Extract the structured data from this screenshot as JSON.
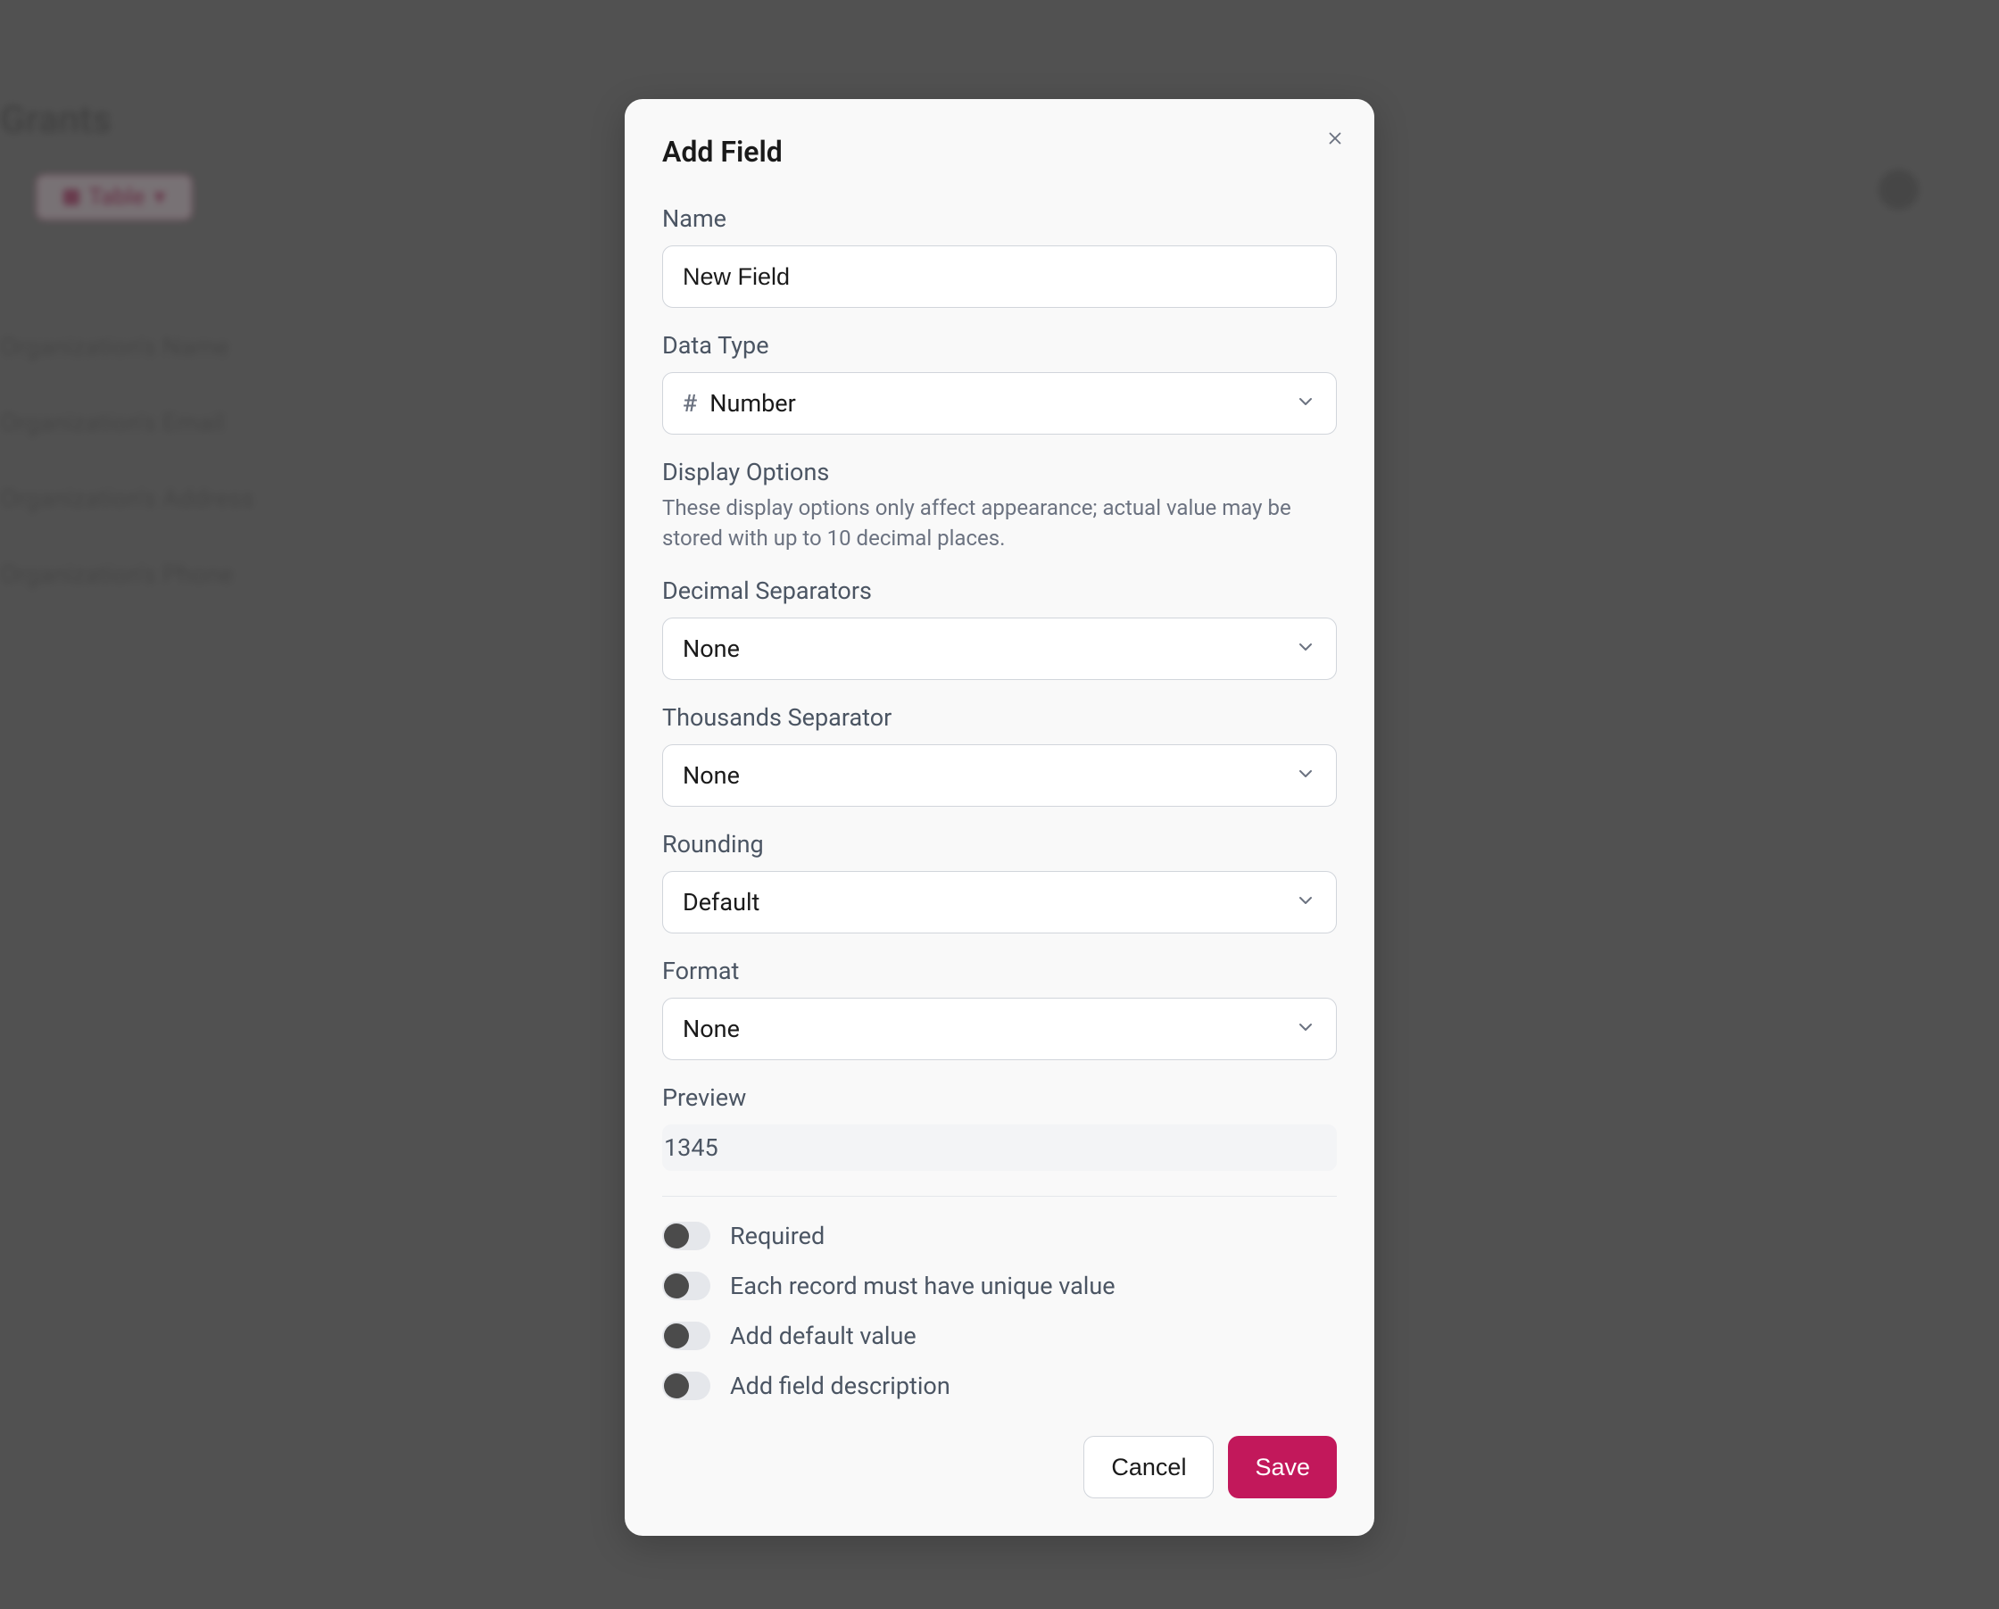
{
  "background": {
    "header": "Grants",
    "pill": "Table",
    "items": [
      "Organization's Name",
      "Organization's Email",
      "Organization's Address",
      "Organization's Phone"
    ]
  },
  "modal": {
    "title": "Add Field",
    "name": {
      "label": "Name",
      "value": "New Field"
    },
    "dataType": {
      "label": "Data Type",
      "icon": "#",
      "value": "Number"
    },
    "displayOptions": {
      "title": "Display Options",
      "desc": "These display options only affect appearance; actual value may be stored with up to 10 decimal places."
    },
    "decimalSeparators": {
      "label": "Decimal Separators",
      "value": "None"
    },
    "thousandsSeparator": {
      "label": "Thousands Separator",
      "value": "None"
    },
    "rounding": {
      "label": "Rounding",
      "value": "Default"
    },
    "format": {
      "label": "Format",
      "value": "None"
    },
    "preview": {
      "label": "Preview",
      "value": "1345"
    },
    "toggles": {
      "required": "Required",
      "unique": "Each record must have unique value",
      "defaultValue": "Add default value",
      "fieldDescription": "Add field description"
    },
    "buttons": {
      "cancel": "Cancel",
      "save": "Save"
    }
  }
}
